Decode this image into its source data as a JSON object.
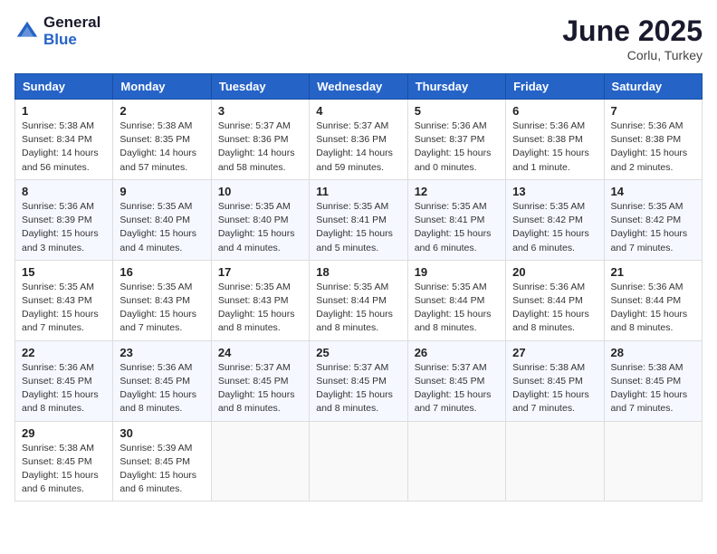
{
  "logo": {
    "general": "General",
    "blue": "Blue"
  },
  "title": "June 2025",
  "location": "Corlu, Turkey",
  "weekdays": [
    "Sunday",
    "Monday",
    "Tuesday",
    "Wednesday",
    "Thursday",
    "Friday",
    "Saturday"
  ],
  "weeks": [
    [
      {
        "day": "1",
        "sunrise": "5:38 AM",
        "sunset": "8:34 PM",
        "daylight": "14 hours and 56 minutes."
      },
      {
        "day": "2",
        "sunrise": "5:38 AM",
        "sunset": "8:35 PM",
        "daylight": "14 hours and 57 minutes."
      },
      {
        "day": "3",
        "sunrise": "5:37 AM",
        "sunset": "8:36 PM",
        "daylight": "14 hours and 58 minutes."
      },
      {
        "day": "4",
        "sunrise": "5:37 AM",
        "sunset": "8:36 PM",
        "daylight": "14 hours and 59 minutes."
      },
      {
        "day": "5",
        "sunrise": "5:36 AM",
        "sunset": "8:37 PM",
        "daylight": "15 hours and 0 minutes."
      },
      {
        "day": "6",
        "sunrise": "5:36 AM",
        "sunset": "8:38 PM",
        "daylight": "15 hours and 1 minute."
      },
      {
        "day": "7",
        "sunrise": "5:36 AM",
        "sunset": "8:38 PM",
        "daylight": "15 hours and 2 minutes."
      }
    ],
    [
      {
        "day": "8",
        "sunrise": "5:36 AM",
        "sunset": "8:39 PM",
        "daylight": "15 hours and 3 minutes."
      },
      {
        "day": "9",
        "sunrise": "5:35 AM",
        "sunset": "8:40 PM",
        "daylight": "15 hours and 4 minutes."
      },
      {
        "day": "10",
        "sunrise": "5:35 AM",
        "sunset": "8:40 PM",
        "daylight": "15 hours and 4 minutes."
      },
      {
        "day": "11",
        "sunrise": "5:35 AM",
        "sunset": "8:41 PM",
        "daylight": "15 hours and 5 minutes."
      },
      {
        "day": "12",
        "sunrise": "5:35 AM",
        "sunset": "8:41 PM",
        "daylight": "15 hours and 6 minutes."
      },
      {
        "day": "13",
        "sunrise": "5:35 AM",
        "sunset": "8:42 PM",
        "daylight": "15 hours and 6 minutes."
      },
      {
        "day": "14",
        "sunrise": "5:35 AM",
        "sunset": "8:42 PM",
        "daylight": "15 hours and 7 minutes."
      }
    ],
    [
      {
        "day": "15",
        "sunrise": "5:35 AM",
        "sunset": "8:43 PM",
        "daylight": "15 hours and 7 minutes."
      },
      {
        "day": "16",
        "sunrise": "5:35 AM",
        "sunset": "8:43 PM",
        "daylight": "15 hours and 7 minutes."
      },
      {
        "day": "17",
        "sunrise": "5:35 AM",
        "sunset": "8:43 PM",
        "daylight": "15 hours and 8 minutes."
      },
      {
        "day": "18",
        "sunrise": "5:35 AM",
        "sunset": "8:44 PM",
        "daylight": "15 hours and 8 minutes."
      },
      {
        "day": "19",
        "sunrise": "5:35 AM",
        "sunset": "8:44 PM",
        "daylight": "15 hours and 8 minutes."
      },
      {
        "day": "20",
        "sunrise": "5:36 AM",
        "sunset": "8:44 PM",
        "daylight": "15 hours and 8 minutes."
      },
      {
        "day": "21",
        "sunrise": "5:36 AM",
        "sunset": "8:44 PM",
        "daylight": "15 hours and 8 minutes."
      }
    ],
    [
      {
        "day": "22",
        "sunrise": "5:36 AM",
        "sunset": "8:45 PM",
        "daylight": "15 hours and 8 minutes."
      },
      {
        "day": "23",
        "sunrise": "5:36 AM",
        "sunset": "8:45 PM",
        "daylight": "15 hours and 8 minutes."
      },
      {
        "day": "24",
        "sunrise": "5:37 AM",
        "sunset": "8:45 PM",
        "daylight": "15 hours and 8 minutes."
      },
      {
        "day": "25",
        "sunrise": "5:37 AM",
        "sunset": "8:45 PM",
        "daylight": "15 hours and 8 minutes."
      },
      {
        "day": "26",
        "sunrise": "5:37 AM",
        "sunset": "8:45 PM",
        "daylight": "15 hours and 7 minutes."
      },
      {
        "day": "27",
        "sunrise": "5:38 AM",
        "sunset": "8:45 PM",
        "daylight": "15 hours and 7 minutes."
      },
      {
        "day": "28",
        "sunrise": "5:38 AM",
        "sunset": "8:45 PM",
        "daylight": "15 hours and 7 minutes."
      }
    ],
    [
      {
        "day": "29",
        "sunrise": "5:38 AM",
        "sunset": "8:45 PM",
        "daylight": "15 hours and 6 minutes."
      },
      {
        "day": "30",
        "sunrise": "5:39 AM",
        "sunset": "8:45 PM",
        "daylight": "15 hours and 6 minutes."
      },
      null,
      null,
      null,
      null,
      null
    ]
  ]
}
